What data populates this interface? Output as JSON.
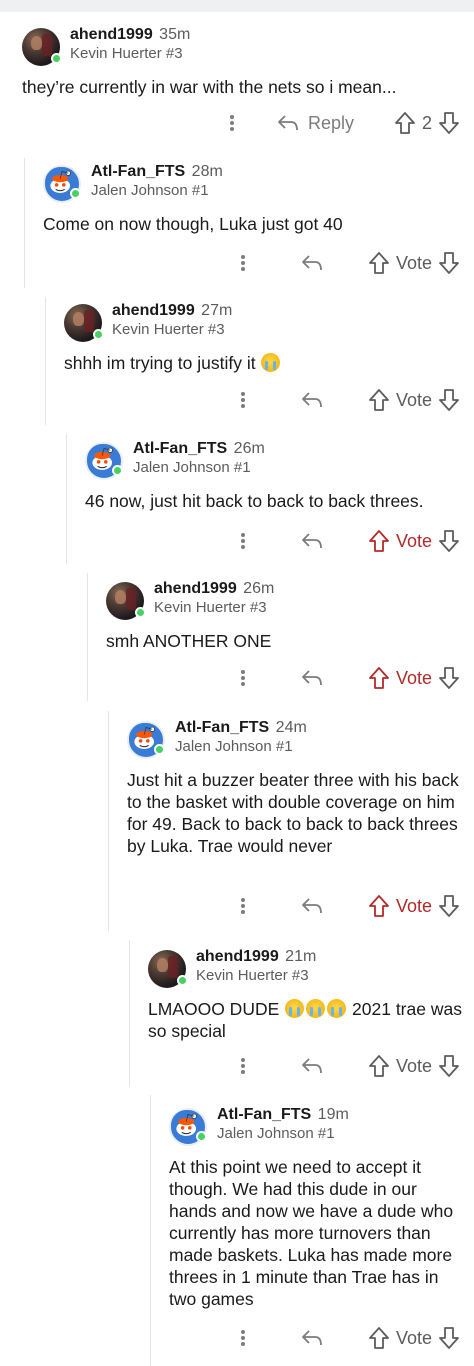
{
  "comments": [
    {
      "user": "ahend1999",
      "time": "35m",
      "flair": "Kevin Huerter #3",
      "avatar": "photo",
      "text": "they’re currently in war with the nets so i mean...",
      "score": "2",
      "show_reply_label": true,
      "reply_label": "Reply",
      "upvoted": false
    },
    {
      "user": "Atl-Fan_FTS",
      "time": "28m",
      "flair": "Jalen Johnson #1",
      "avatar": "snoo",
      "text": "Come on now though, Luka just got 40",
      "score": "Vote",
      "upvoted": false
    },
    {
      "user": "ahend1999",
      "time": "27m",
      "flair": "Kevin Huerter #3",
      "avatar": "photo",
      "text": "shhh im trying to justify it",
      "emoji_count": 1,
      "score": "Vote",
      "upvoted": false
    },
    {
      "user": "Atl-Fan_FTS",
      "time": "26m",
      "flair": "Jalen Johnson #1",
      "avatar": "snoo",
      "text": "46 now, just hit back to back to back threes.",
      "score": "Vote",
      "upvoted": true
    },
    {
      "user": "ahend1999",
      "time": "26m",
      "flair": "Kevin Huerter #3",
      "avatar": "photo",
      "text": "smh ANOTHER ONE",
      "score": "Vote",
      "upvoted": true
    },
    {
      "user": "Atl-Fan_FTS",
      "time": "24m",
      "flair": "Jalen Johnson #1",
      "avatar": "snoo",
      "text": "Just hit a buzzer beater three with his back to the basket with double coverage on him for 49. Back to back to back to back threes by Luka. Trae would never",
      "score": "Vote",
      "upvoted": true
    },
    {
      "user": "ahend1999",
      "time": "21m",
      "flair": "Kevin Huerter #3",
      "avatar": "photo",
      "text_before": "LMAOOO DUDE",
      "text_after": "2021 trae was so special",
      "emoji_count": 3,
      "score": "Vote",
      "upvoted": false
    },
    {
      "user": "Atl-Fan_FTS",
      "time": "19m",
      "flair": "Jalen Johnson #1",
      "avatar": "snoo",
      "text": "At this point we need to accept it though. We had this dude in our hands and now we have a dude who currently has more turnovers than made baskets. Luka has made more threes in 1 minute than Trae has in two games",
      "score": "Vote",
      "upvoted": false
    }
  ],
  "icons": {
    "more": "three-dots-vertical-icon",
    "reply": "reply-arrow-icon",
    "upvote": "upvote-arrow-icon",
    "downvote": "downvote-arrow-icon"
  },
  "colors": {
    "upvoted": "#b22a2a",
    "online": "#46d160",
    "muted": "#7c7c7c"
  }
}
